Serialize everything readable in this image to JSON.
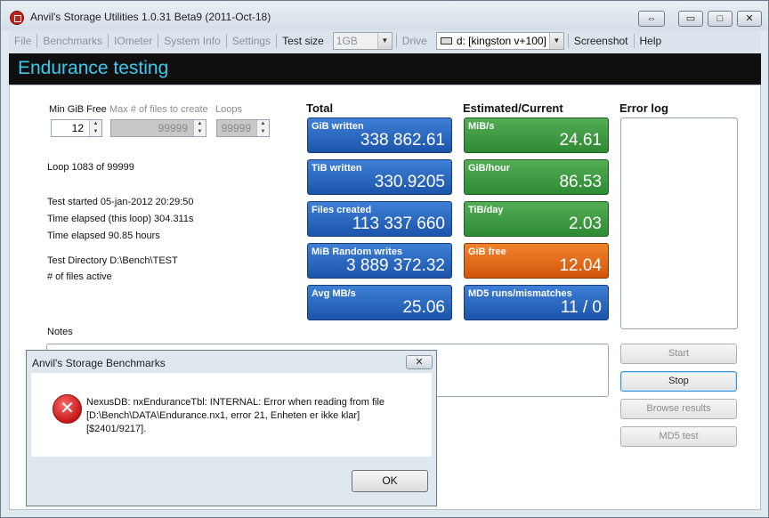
{
  "window": {
    "title": "Anvil's Storage Utilities 1.0.31 Beta9 (2011-Oct-18)",
    "btn_restore": "⇔",
    "btn_minimize": "▭",
    "btn_maximize": "□",
    "btn_close": "✕"
  },
  "menu": {
    "file": "File",
    "benchmarks": "Benchmarks",
    "iometer": "IOmeter",
    "system_info": "System Info",
    "settings": "Settings",
    "test_size_label": "Test size",
    "test_size_value": "1GB",
    "drive_label": "Drive",
    "drive_value": "d: [kingston v+100]",
    "screenshot": "Screenshot",
    "help": "Help"
  },
  "header": {
    "title": "Endurance testing"
  },
  "params": {
    "min_free_label": "Min GiB Free",
    "min_free_value": "12",
    "max_files_label": "Max # of files to create",
    "max_files_value": "99999",
    "loops_label": "Loops",
    "loops_value": "99999"
  },
  "status": {
    "loop": "Loop 1083 of 99999",
    "started": "Test started 05-jan-2012 20:29:50",
    "elapsed_loop": "Time elapsed (this loop) 304.311s",
    "elapsed": "Time elapsed 90.85 hours",
    "directory": "Test Directory D:\\Bench\\TEST",
    "files_active": "# of files active"
  },
  "total": {
    "title": "Total",
    "tiles": [
      {
        "label": "GiB written",
        "value": "338 862.61"
      },
      {
        "label": "TiB written",
        "value": "330.9205"
      },
      {
        "label": "Files created",
        "value": "113 337 660"
      },
      {
        "label": "MiB Random writes",
        "value": "3 889 372.32"
      },
      {
        "label": "Avg MB/s",
        "value": "25.06"
      }
    ]
  },
  "current": {
    "title": "Estimated/Current",
    "tiles": [
      {
        "label": "MiB/s",
        "value": "24.61"
      },
      {
        "label": "GiB/hour",
        "value": "86.53"
      },
      {
        "label": "TiB/day",
        "value": "2.03"
      },
      {
        "label": "GiB free",
        "value": "12.04"
      },
      {
        "label": "MD5 runs/mismatches",
        "value": "11 / 0"
      }
    ]
  },
  "error_log": {
    "title": "Error log"
  },
  "notes": {
    "label": "Notes"
  },
  "buttons": {
    "start": "Start",
    "stop": "Stop",
    "browse": "Browse results",
    "md5": "MD5 test"
  },
  "dialog": {
    "title": "Anvil's Storage Benchmarks",
    "close": "✕",
    "icon": "error-icon",
    "line1": "NexusDB: nxEnduranceTbl: INTERNAL: Error when reading from file",
    "line2": "[D:\\Bench\\DATA\\Endurance.nx1, error 21, Enheten er ikke klar]",
    "line3": "[$2401/9217].",
    "ok": "OK"
  },
  "colors": {
    "header_text": "#3cc9f0",
    "tile_blue": "#2a66bf",
    "tile_green": "#3c9a40",
    "tile_orange": "#e26a1c"
  }
}
